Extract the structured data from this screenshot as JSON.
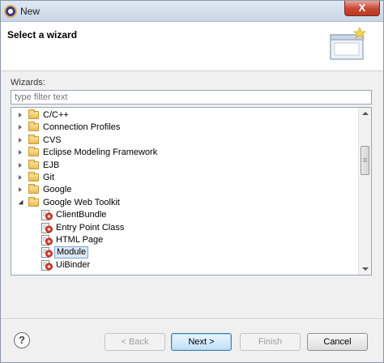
{
  "window": {
    "title": "New",
    "close_label": "X"
  },
  "banner": {
    "title": "Select a wizard"
  },
  "wizards": {
    "label": "Wizards:",
    "filter_placeholder": "type filter text"
  },
  "tree": {
    "items": [
      {
        "label": "C/C++",
        "kind": "folder",
        "state": "collapsed",
        "level": 0
      },
      {
        "label": "Connection Profiles",
        "kind": "folder",
        "state": "collapsed",
        "level": 0
      },
      {
        "label": "CVS",
        "kind": "folder",
        "state": "collapsed",
        "level": 0
      },
      {
        "label": "Eclipse Modeling Framework",
        "kind": "folder",
        "state": "collapsed",
        "level": 0
      },
      {
        "label": "EJB",
        "kind": "folder",
        "state": "collapsed",
        "level": 0
      },
      {
        "label": "Git",
        "kind": "folder",
        "state": "collapsed",
        "level": 0
      },
      {
        "label": "Google",
        "kind": "folder",
        "state": "collapsed",
        "level": 0
      },
      {
        "label": "Google Web Toolkit",
        "kind": "folder",
        "state": "expanded",
        "level": 0
      },
      {
        "label": "ClientBundle",
        "kind": "gwt",
        "level": 1
      },
      {
        "label": "Entry Point Class",
        "kind": "gwt",
        "level": 1
      },
      {
        "label": "HTML Page",
        "kind": "gwt",
        "level": 1
      },
      {
        "label": "Module",
        "kind": "gwt",
        "level": 1,
        "selected": true
      },
      {
        "label": "UiBinder",
        "kind": "gwt",
        "level": 1
      }
    ]
  },
  "buttons": {
    "help": "?",
    "back": "< Back",
    "next": "Next >",
    "finish": "Finish",
    "cancel": "Cancel"
  },
  "colors": {
    "selection_bg": "#dce9f7",
    "default_button": "#bfe0f7"
  }
}
